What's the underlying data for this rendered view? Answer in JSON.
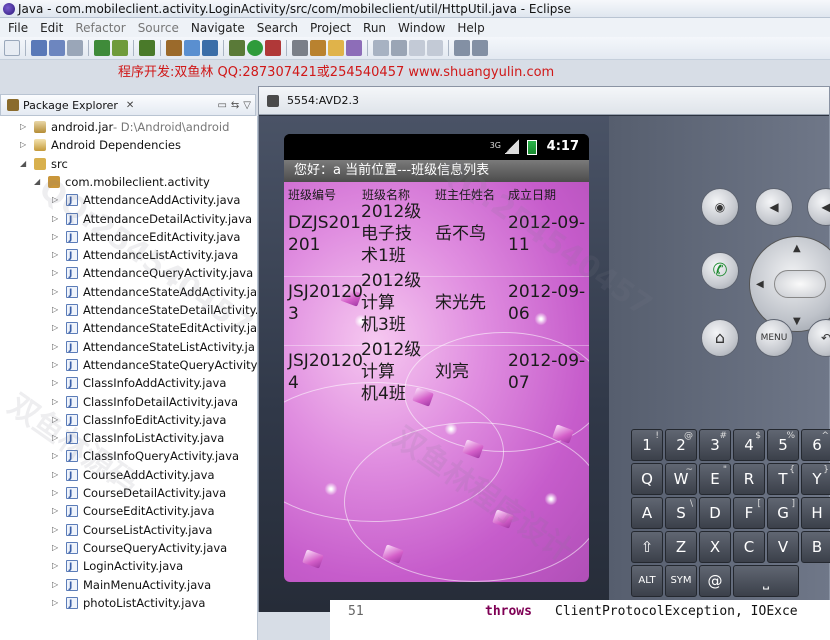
{
  "window": {
    "title": "Java - com.mobileclient.activity.LoginActivity/src/com/mobileclient/util/HttpUtil.java - Eclipse"
  },
  "menu": [
    "File",
    "Edit",
    "Refactor",
    "Source",
    "Navigate",
    "Search",
    "Project",
    "Run",
    "Window",
    "Help"
  ],
  "promo": "程序开发:双鱼林 QQ:287307421或254540457 www.shuangyulin.com",
  "package_explorer": {
    "tab_label": "Package Explorer",
    "close": "✕",
    "items": [
      {
        "label": "android.jar",
        "suffix": " - D:\\Android\\android",
        "indent": 1,
        "icon": "jar"
      },
      {
        "label": "Android Dependencies",
        "suffix": "",
        "indent": 1,
        "icon": "lib"
      },
      {
        "label": "src",
        "suffix": "",
        "indent": 1,
        "icon": "src"
      },
      {
        "label": "com.mobileclient.activity",
        "suffix": "",
        "indent": 2,
        "icon": "package"
      },
      {
        "label": "AttendanceAddActivity.java",
        "suffix": "",
        "indent": 3,
        "icon": "java"
      },
      {
        "label": "AttendanceDetailActivity.java",
        "suffix": "",
        "indent": 3,
        "icon": "java"
      },
      {
        "label": "AttendanceEditActivity.java",
        "suffix": "",
        "indent": 3,
        "icon": "java"
      },
      {
        "label": "AttendanceListActivity.java",
        "suffix": "",
        "indent": 3,
        "icon": "java"
      },
      {
        "label": "AttendanceQueryActivity.java",
        "suffix": "",
        "indent": 3,
        "icon": "java"
      },
      {
        "label": "AttendanceStateAddActivity.ja",
        "suffix": "",
        "indent": 3,
        "icon": "java"
      },
      {
        "label": "AttendanceStateDetailActivity.",
        "suffix": "",
        "indent": 3,
        "icon": "java"
      },
      {
        "label": "AttendanceStateEditActivity.ja",
        "suffix": "",
        "indent": 3,
        "icon": "java"
      },
      {
        "label": "AttendanceStateListActivity.ja",
        "suffix": "",
        "indent": 3,
        "icon": "java"
      },
      {
        "label": "AttendanceStateQueryActivity.",
        "suffix": "",
        "indent": 3,
        "icon": "java"
      },
      {
        "label": "ClassInfoAddActivity.java",
        "suffix": "",
        "indent": 3,
        "icon": "java"
      },
      {
        "label": "ClassInfoDetailActivity.java",
        "suffix": "",
        "indent": 3,
        "icon": "java"
      },
      {
        "label": "ClassInfoEditActivity.java",
        "suffix": "",
        "indent": 3,
        "icon": "java"
      },
      {
        "label": "ClassInfoListActivity.java",
        "suffix": "",
        "indent": 3,
        "icon": "java"
      },
      {
        "label": "ClassInfoQueryActivity.java",
        "suffix": "",
        "indent": 3,
        "icon": "java"
      },
      {
        "label": "CourseAddActivity.java",
        "suffix": "",
        "indent": 3,
        "icon": "java"
      },
      {
        "label": "CourseDetailActivity.java",
        "suffix": "",
        "indent": 3,
        "icon": "java"
      },
      {
        "label": "CourseEditActivity.java",
        "suffix": "",
        "indent": 3,
        "icon": "java"
      },
      {
        "label": "CourseListActivity.java",
        "suffix": "",
        "indent": 3,
        "icon": "java"
      },
      {
        "label": "CourseQueryActivity.java",
        "suffix": "",
        "indent": 3,
        "icon": "java"
      },
      {
        "label": "LoginActivity.java",
        "suffix": "",
        "indent": 3,
        "icon": "java"
      },
      {
        "label": "MainMenuActivity.java",
        "suffix": "",
        "indent": 3,
        "icon": "java"
      },
      {
        "label": "photoListActivity.java",
        "suffix": "",
        "indent": 3,
        "icon": "java"
      }
    ]
  },
  "emulator": {
    "window_title": "5554:AVD2.3",
    "status": {
      "network": "3G",
      "time": "4:17"
    },
    "app_title": "您好：a   当前位置---班级信息列表",
    "table": {
      "headers": [
        "班级编号",
        "班级名称",
        "班主任姓名",
        "成立日期"
      ],
      "rows": [
        {
          "code": "DZJS201\n201",
          "name": "2012级\n电子技\n术1班",
          "teacher": "岳不鸟",
          "date": "2012-09-\n11"
        },
        {
          "code": "JSJ20120\n3",
          "name": "2012级\n计算\n机3班",
          "teacher": "宋光先",
          "date": "2012-09-\n06"
        },
        {
          "code": "JSJ20120\n4",
          "name": "2012级\n计算\n机4班",
          "teacher": "刘亮",
          "date": "2012-09-\n07"
        }
      ]
    },
    "buttons": {
      "menu": "MENU"
    },
    "keys": [
      {
        "main": "1",
        "alt": "!"
      },
      {
        "main": "2",
        "alt": "@"
      },
      {
        "main": "3",
        "alt": "#"
      },
      {
        "main": "4",
        "alt": "$"
      },
      {
        "main": "5",
        "alt": "%"
      },
      {
        "main": "6",
        "alt": "^"
      },
      {
        "main": "Q",
        "alt": ""
      },
      {
        "main": "W",
        "alt": "~"
      },
      {
        "main": "E",
        "alt": "\""
      },
      {
        "main": "R",
        "alt": ""
      },
      {
        "main": "T",
        "alt": "{"
      },
      {
        "main": "Y",
        "alt": "}"
      },
      {
        "main": "A",
        "alt": ""
      },
      {
        "main": "S",
        "alt": "\\"
      },
      {
        "main": "D",
        "alt": ""
      },
      {
        "main": "F",
        "alt": "["
      },
      {
        "main": "G",
        "alt": "]"
      },
      {
        "main": "H",
        "alt": ""
      },
      {
        "main": "⇧",
        "alt": ""
      },
      {
        "main": "Z",
        "alt": ""
      },
      {
        "main": "X",
        "alt": ""
      },
      {
        "main": "C",
        "alt": ""
      },
      {
        "main": "V",
        "alt": ""
      },
      {
        "main": "B",
        "alt": ""
      },
      {
        "main": "ALT",
        "alt": ""
      },
      {
        "main": "SYM",
        "alt": ""
      },
      {
        "main": "@",
        "alt": ""
      },
      {
        "main": "⎵",
        "alt": ""
      }
    ]
  },
  "editor": {
    "line_number": "51",
    "keyword": "throws",
    "text": "ClientProtocolException, IOExce"
  },
  "watermark": [
    "QQ:254540457",
    "双鱼林源码",
    "双鱼林程序设计"
  ]
}
